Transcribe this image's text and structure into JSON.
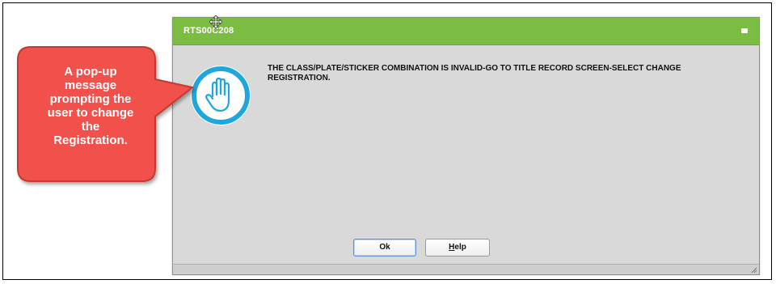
{
  "dialog": {
    "title": "RTS00C208",
    "message": "THE CLASS/PLATE/STICKER COMBINATION IS INVALID-GO TO TITLE RECORD SCREEN-SELECT CHANGE REGISTRATION.",
    "icon": "stop-hand-icon",
    "buttons": {
      "ok_label": "Ok",
      "help_prefix": "H",
      "help_rest": "elp"
    },
    "colors": {
      "titlebar": "#7bbd42",
      "icon_ring": "#1fa7dd",
      "background": "#d9d9d9"
    }
  },
  "callout": {
    "lines": [
      "A pop-up",
      "message",
      "prompting the",
      "user to change",
      "the",
      "Registration."
    ],
    "fill_color": "#f2514b",
    "border_color": "#c13a33"
  }
}
